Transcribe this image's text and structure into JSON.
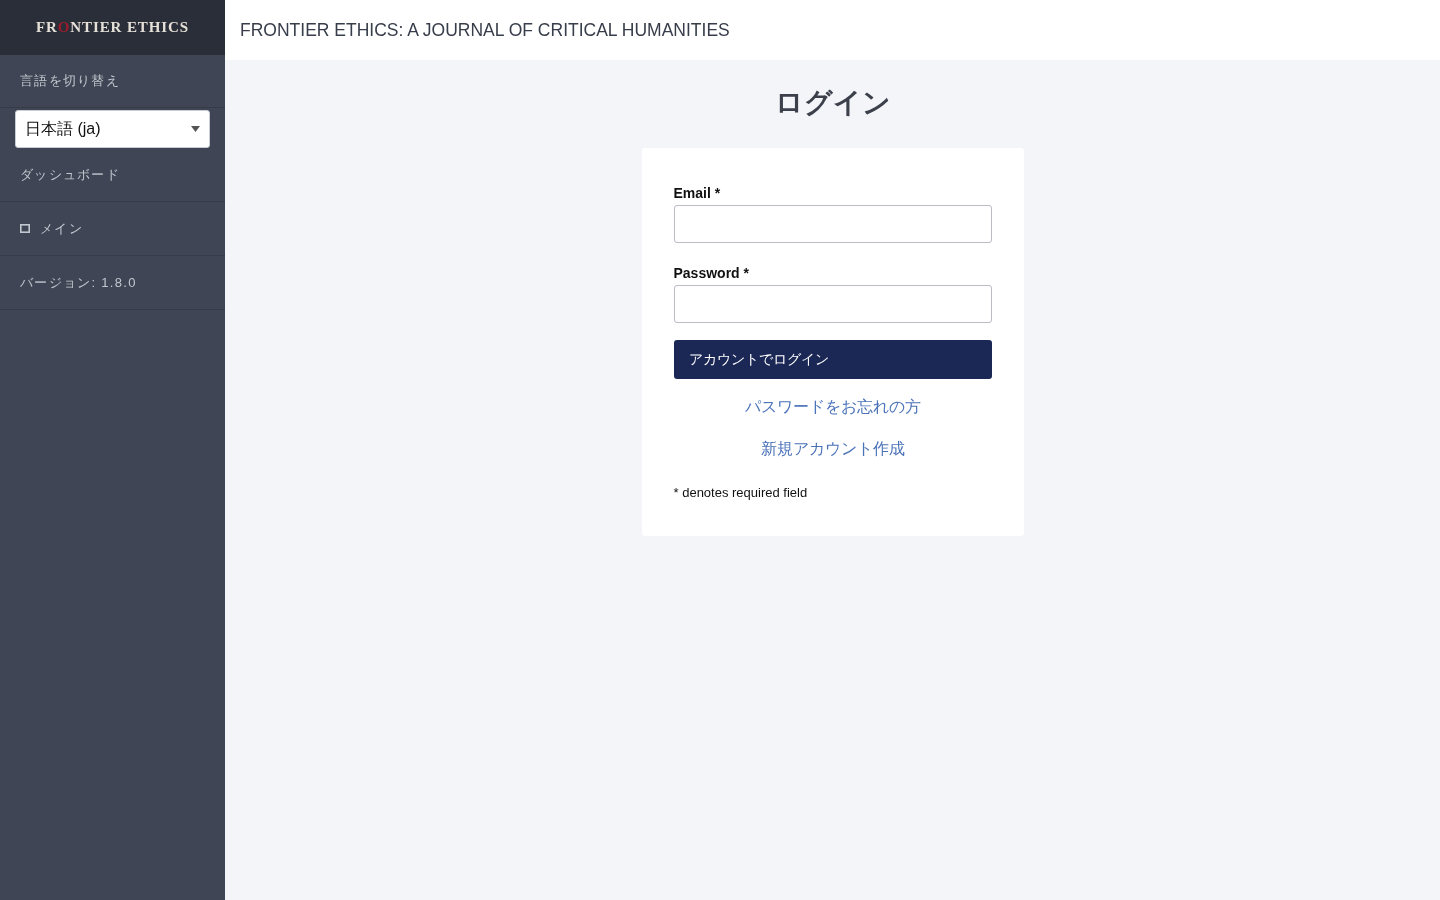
{
  "sidebar": {
    "logo": {
      "parts": [
        {
          "text": "FR",
          "accent": false
        },
        {
          "text": "O",
          "accent": true
        },
        {
          "text": "NTIER ETHICS",
          "accent": false
        }
      ]
    },
    "items": [
      {
        "kind": "heading",
        "label": "言語を切り替え"
      },
      {
        "kind": "select",
        "value": "日本語 (ja)"
      },
      {
        "kind": "link",
        "label": "ダッシュボード"
      },
      {
        "kind": "icon-link",
        "label": "メイン"
      },
      {
        "kind": "text",
        "label": "バージョン: 1.8.0"
      }
    ]
  },
  "header": {
    "title": "FRONTIER ETHICS: A JOURNAL OF CRITICAL HUMANITIES"
  },
  "login": {
    "heading": "ログイン",
    "fields": [
      {
        "label": "Email *"
      },
      {
        "label": "Password *"
      }
    ],
    "submit_button": "アカウントでログイン",
    "links": [
      "パスワードをお忘れの方",
      "新規アカウント作成"
    ],
    "note": "* denotes required field"
  }
}
